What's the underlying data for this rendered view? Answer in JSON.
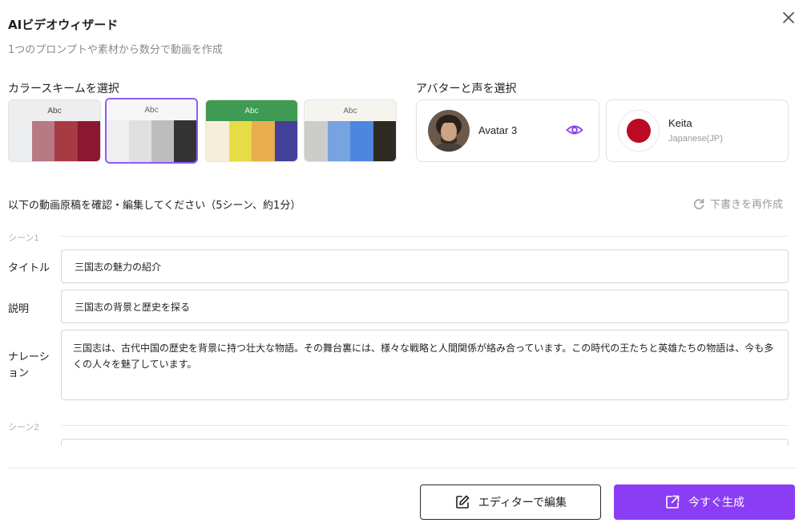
{
  "dialog": {
    "title": "AIビデオウィザード",
    "subtitle": "1つのプロンプトや素材から数分で動画を作成"
  },
  "color_scheme": {
    "label": "カラースキームを選択",
    "selected_index": 1,
    "schemes": [
      {
        "sample": "Abc",
        "head_bg": "#eeeeee",
        "head_fg": "#444444",
        "swatches": [
          "#eceef0",
          "#b87884",
          "#a83a46",
          "#8c1730"
        ]
      },
      {
        "sample": "Abc",
        "head_bg": "#f6f6f6",
        "head_fg": "#666666",
        "swatches": [
          "#efefef",
          "#e0e0e0",
          "#bdbdbd",
          "#333333"
        ]
      },
      {
        "sample": "Abc",
        "head_bg": "#3f9a54",
        "head_fg": "#e8f5ea",
        "swatches": [
          "#f6eed8",
          "#e6dc46",
          "#e8ad4d",
          "#43409a"
        ]
      },
      {
        "sample": "Abc",
        "head_bg": "#f6f4ee",
        "head_fg": "#666666",
        "swatches": [
          "#ccccc8",
          "#77a3e0",
          "#4e86df",
          "#2e2b22"
        ]
      }
    ]
  },
  "avatar_voice": {
    "label": "アバターと声を選択",
    "avatar_name": "Avatar 3",
    "voice_name": "Keita",
    "voice_lang": "Japanese(JP)"
  },
  "script": {
    "confirm_text": "以下の動画原稿を確認・編集してください（5シーン、約1分）",
    "regenerate_label": "下書きを再作成"
  },
  "scenes": [
    {
      "label": "シーン1",
      "title_label": "タイトル",
      "title_value": "三国志の魅力の紹介",
      "desc_label": "説明",
      "desc_value": "三国志の背景と歴史を探る",
      "narration_label": "ナレーション",
      "narration_value": "三国志は、古代中国の歴史を背景に持つ壮大な物語。その舞台裏には、様々な戦略と人間関係が絡み合っています。この時代の王たちと英雄たちの物語は、今も多くの人々を魅了しています。"
    },
    {
      "label": "シーン2"
    }
  ],
  "footer": {
    "edit_label": "エディターで編集",
    "generate_label": "今すぐ生成"
  },
  "colors": {
    "accent": "#8b3cf5",
    "selected_border": "#8b5cf6"
  }
}
